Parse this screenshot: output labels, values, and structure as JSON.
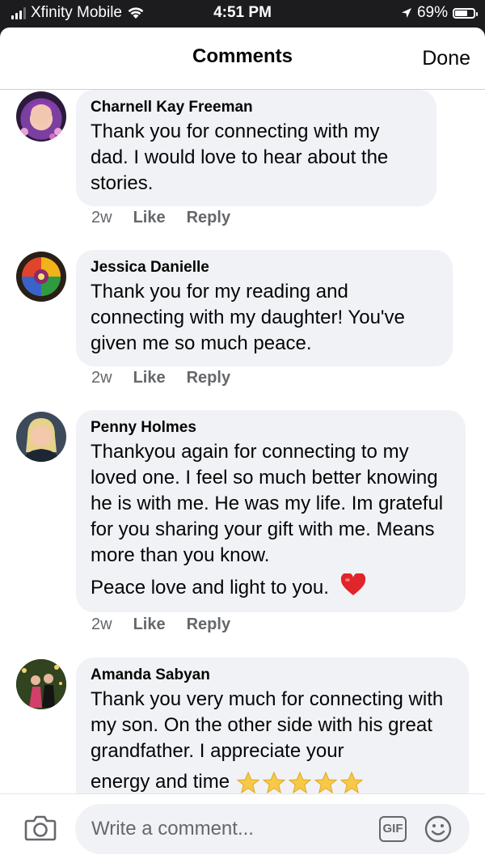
{
  "status_bar": {
    "carrier": "Xfinity Mobile",
    "time": "4:51 PM",
    "battery": "69%",
    "battery_level": 0.69
  },
  "header": {
    "title": "Comments",
    "done_label": "Done"
  },
  "comments": [
    {
      "author": "Charnell Kay Freeman",
      "text": "Thank you for connecting with my dad.  I would love to hear about the stories.",
      "time": "2w",
      "like": "Like",
      "reply": "Reply"
    },
    {
      "author": "Jessica Danielle",
      "text": "Thank you for my reading and connecting with my daughter! You've given me so much peace.",
      "time": "2w",
      "like": "Like",
      "reply": "Reply"
    },
    {
      "author": "Penny Holmes",
      "text": "Thankyou again for connecting to my loved one. I feel so much better knowing he is with me. He was my life. Im grateful for you sharing your gift with me. Means more than you know.",
      "text_last": "Peace love and light to you.",
      "time": "2w",
      "like": "Like",
      "reply": "Reply"
    },
    {
      "author": "Amanda Sabyan",
      "text": "Thank you very much for connecting with my son. On the other side with his great grandfather. I appreciate your",
      "text_last": "energy and time"
    }
  ],
  "composer": {
    "placeholder": "Write a comment...",
    "gif_label": "GIF"
  },
  "icons": [
    "signal-icon",
    "wifi-icon",
    "location-arrow-icon",
    "battery-icon",
    "camera-icon",
    "gif-icon",
    "emoji-icon",
    "heart-emoji",
    "star-emoji"
  ],
  "colors": {
    "bubble": "#f0f2f5",
    "meta_text": "#65676b",
    "heart": "#e0252b",
    "star": "#f7c948"
  }
}
